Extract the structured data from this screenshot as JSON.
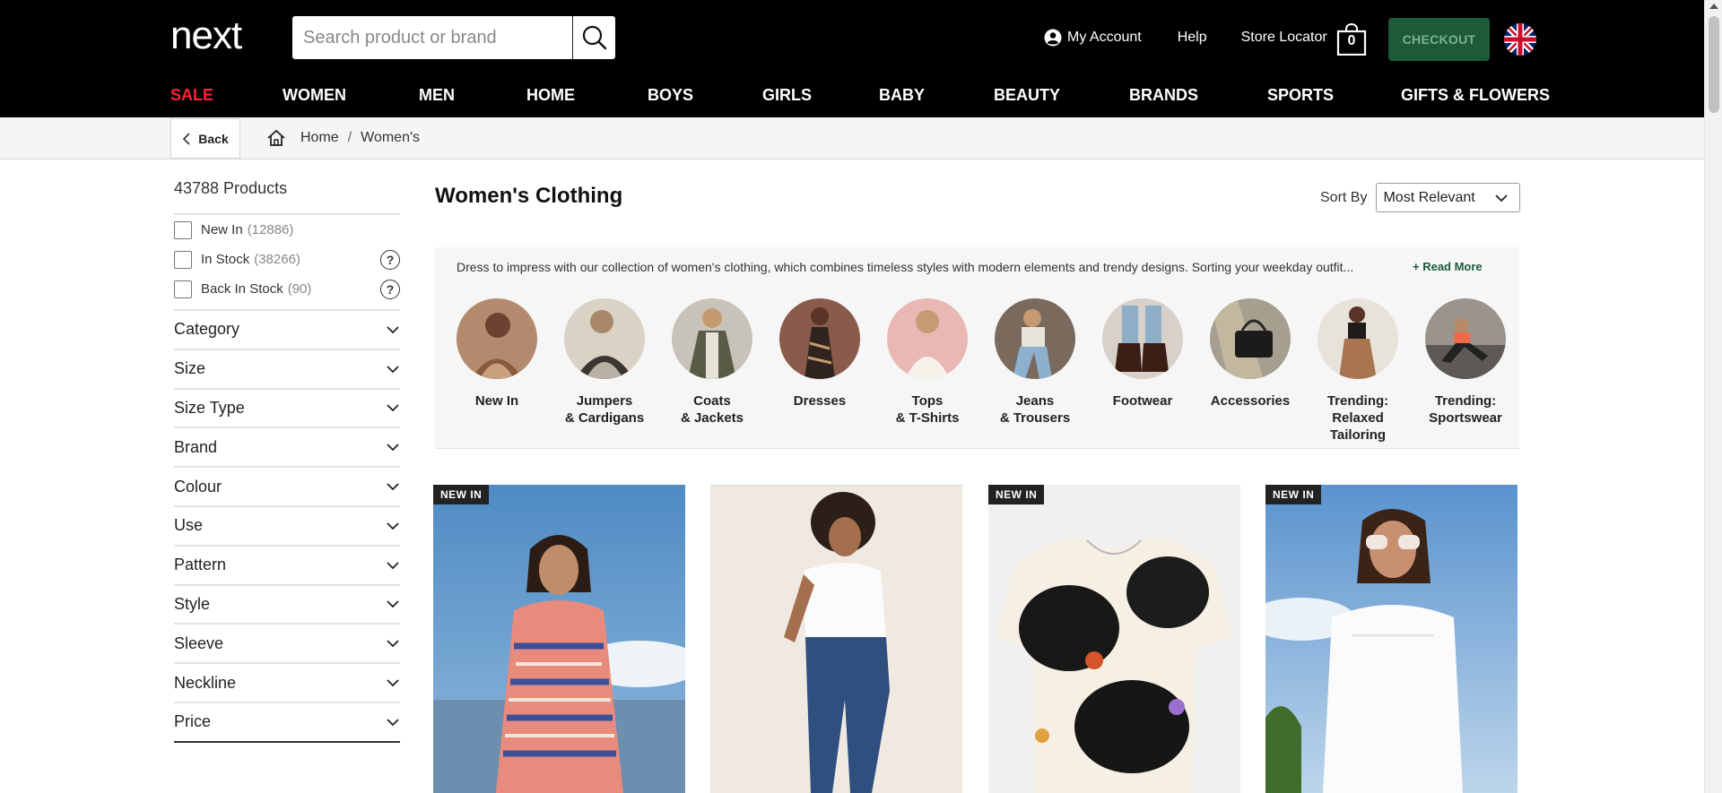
{
  "header": {
    "logo_text": "next",
    "search_placeholder": "Search product or brand",
    "my_account": "My Account",
    "help": "Help",
    "store_locator": "Store Locator",
    "bag_count": "0",
    "checkout": "CHECKOUT",
    "flag_icon": "uk-flag-icon"
  },
  "nav": [
    "SALE",
    "WOMEN",
    "MEN",
    "HOME",
    "BOYS",
    "GIRLS",
    "BABY",
    "BEAUTY",
    "BRANDS",
    "SPORTS",
    "GIFTS & FLOWERS"
  ],
  "breadcrumb": {
    "back": "Back",
    "home": "Home",
    "separator": "/",
    "current": "Women's"
  },
  "sidebar": {
    "product_count": "43788 Products",
    "checks": [
      {
        "label": "New In",
        "count": "(12886)"
      },
      {
        "label": "In Stock",
        "count": "(38266)"
      },
      {
        "label": "Back In Stock",
        "count": "(90)"
      }
    ],
    "help_glyph": "?",
    "facets": [
      "Category",
      "Size",
      "Size Type",
      "Brand",
      "Colour",
      "Use",
      "Pattern",
      "Style",
      "Sleeve",
      "Neckline",
      "Price"
    ]
  },
  "main": {
    "title": "Women's Clothing",
    "sort_label": "Sort By",
    "sort_value": "Most Relevant",
    "description": "Dress to impress with our collection of women's clothing, which combines timeless styles with modern elements and trendy designs. Sorting your weekday outfit...",
    "read_more": "+ Read More",
    "categories": [
      "New In",
      "Jumpers\n& Cardigans",
      "Coats\n& Jackets",
      "Dresses",
      "Tops\n& T-Shirts",
      "Jeans\n& Trousers",
      "Footwear",
      "Accessories",
      "Trending:\nRelaxed\nTailoring",
      "Trending:\nSportswear"
    ],
    "products": [
      {
        "badge": "NEW IN"
      },
      {
        "badge": ""
      },
      {
        "badge": "NEW IN"
      },
      {
        "badge": "NEW IN"
      }
    ]
  },
  "colors": {
    "sale": "#ff1f3a",
    "checkout_bg": "#1d5a37",
    "header_bg": "#000000"
  }
}
